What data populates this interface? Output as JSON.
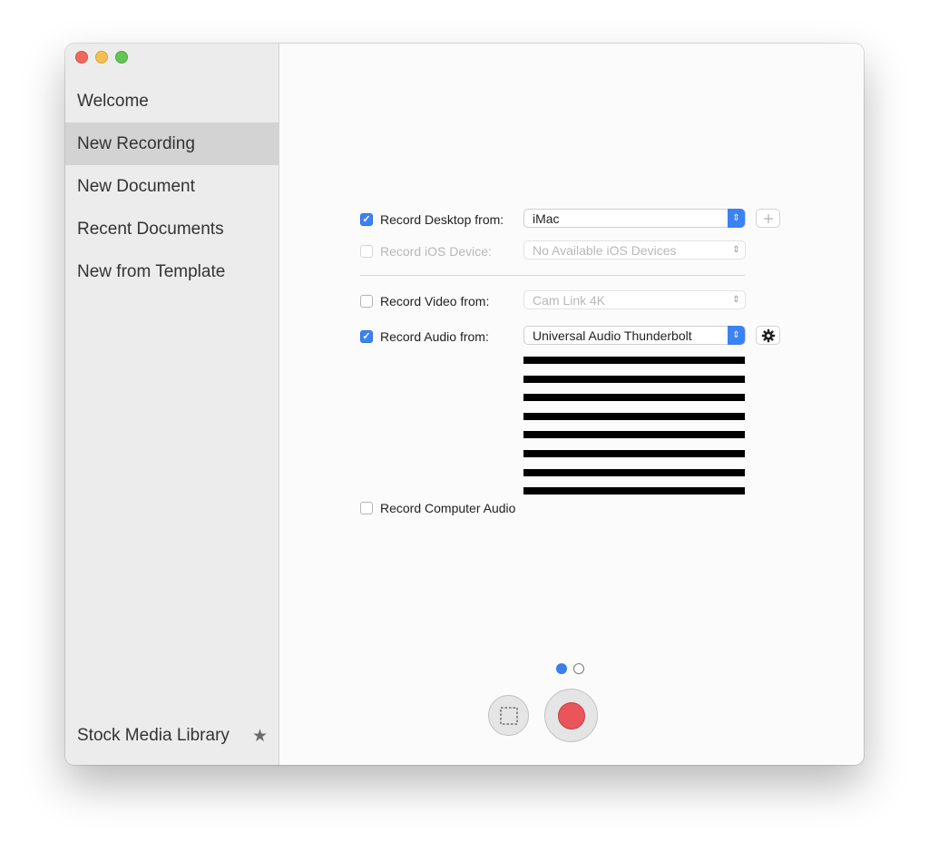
{
  "sidebar": {
    "items": [
      {
        "label": "Welcome"
      },
      {
        "label": "New Recording",
        "active": true
      },
      {
        "label": "New Document"
      },
      {
        "label": "Recent Documents"
      },
      {
        "label": "New from Template"
      }
    ],
    "footer_label": "Stock Media Library",
    "footer_icon": "star-icon"
  },
  "recording": {
    "desktop": {
      "label": "Record Desktop from:",
      "checked": true,
      "value": "iMac"
    },
    "ios": {
      "label": "Record iOS Device:",
      "checked": false,
      "enabled": false,
      "value": "No Available iOS Devices"
    },
    "video": {
      "label": "Record Video from:",
      "checked": false,
      "value": "Cam Link 4K"
    },
    "audio": {
      "label": "Record Audio from:",
      "checked": true,
      "value": "Universal Audio Thunderbolt"
    },
    "computer_audio": {
      "label": "Record Computer Audio",
      "checked": false
    }
  },
  "audio_meter": {
    "bars": 8
  },
  "pages": {
    "count": 2,
    "current": 1
  },
  "colors": {
    "accent": "#3b82f6",
    "record": "#e8555a",
    "sidebar_bg": "#ececec",
    "selection": "#d3d3d3"
  }
}
